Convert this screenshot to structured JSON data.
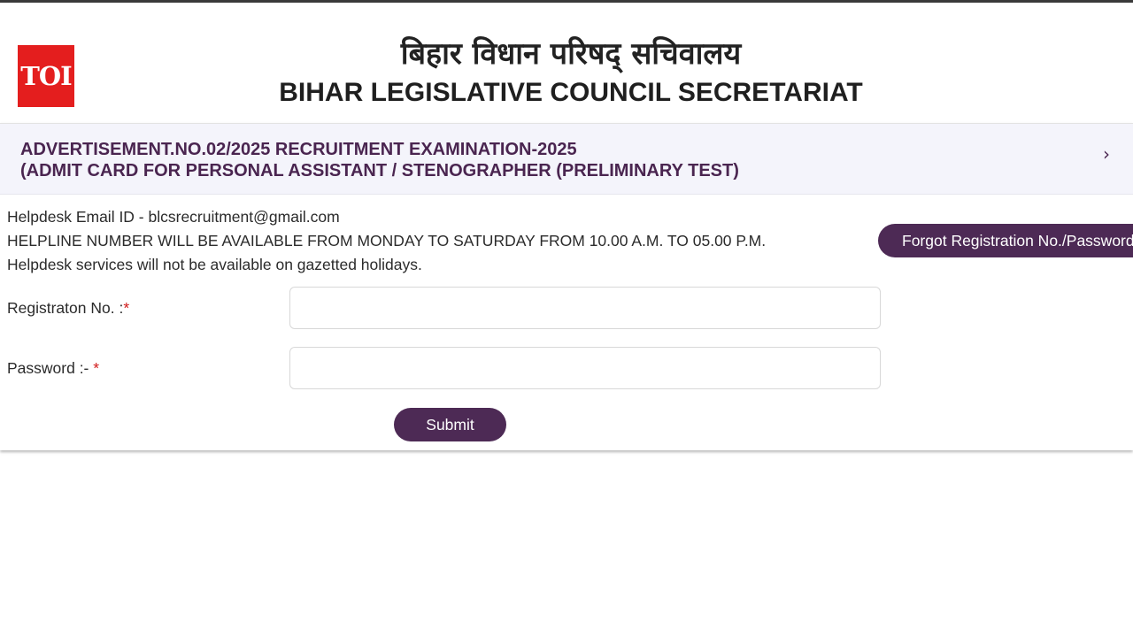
{
  "logo": {
    "text": "TOI",
    "color": "#e41e1e"
  },
  "header": {
    "title_hindi": "बिहार विधान परिषद् सचिवालय",
    "title_english": "BIHAR LEGISLATIVE COUNCIL SECRETARIAT"
  },
  "panel": {
    "heading_line1": "ADVERTISEMENT.NO.02/2025 RECRUITMENT EXAMINATION-2025",
    "heading_line2": "(ADMIT CARD FOR PERSONAL ASSISTANT / STENOGRAPHER (PRELIMINARY TEST)",
    "chevron_icon": "chevron-right-icon",
    "accent_color": "#4d2a55"
  },
  "helpdesk": {
    "email_line": "Helpdesk Email ID - blcsrecruitment@gmail.com",
    "helpline_line": "HELPLINE NUMBER WILL BE AVAILABLE FROM MONDAY TO SATURDAY FROM 10.00 A.M. TO 05.00 P.M.",
    "holiday_line": "Helpdesk services will not be available on gazetted holidays."
  },
  "form": {
    "forgot_label": "Forgot Registration No./Password",
    "registration_label": "Registraton No. :",
    "password_label": "Password :- ",
    "required_marker": "*",
    "registration_value": "",
    "password_value": "",
    "submit_label": "Submit"
  }
}
